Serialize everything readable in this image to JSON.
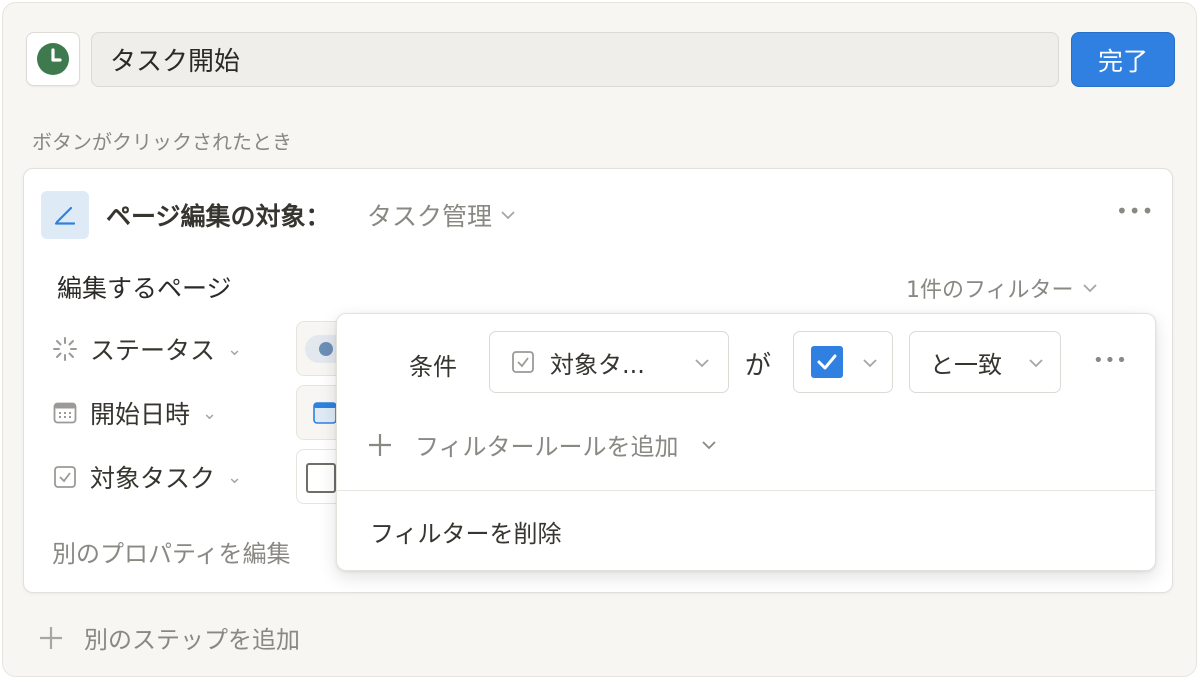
{
  "header": {
    "title_value": "タスク開始",
    "done_label": "完了"
  },
  "section": {
    "trigger_label": "ボタンがクリックされたとき"
  },
  "step": {
    "title": "ページ編集の対象：",
    "target": "タスク管理",
    "more_label": "•••",
    "edit_pages_label": "編集するページ",
    "filter_count": "1件のフィルター",
    "properties": [
      {
        "label": "ステータス",
        "icon": "status-icon"
      },
      {
        "label": "開始日時",
        "icon": "calendar-icon"
      },
      {
        "label": "対象タスク",
        "icon": "checkbox-icon"
      }
    ],
    "another_property_label": "別のプロパティを編集"
  },
  "add_step_label": "別のステップを追加",
  "filter_popover": {
    "condition_label": "条件",
    "property_select": "対象タ...",
    "ga_label": "が",
    "operator_select": "と一致",
    "more_label": "•••",
    "add_rule_label": "フィルタールールを追加",
    "delete_label": "フィルターを削除"
  },
  "colors": {
    "accent": "#2f80e0",
    "clock_green": "#3f7a4f"
  }
}
